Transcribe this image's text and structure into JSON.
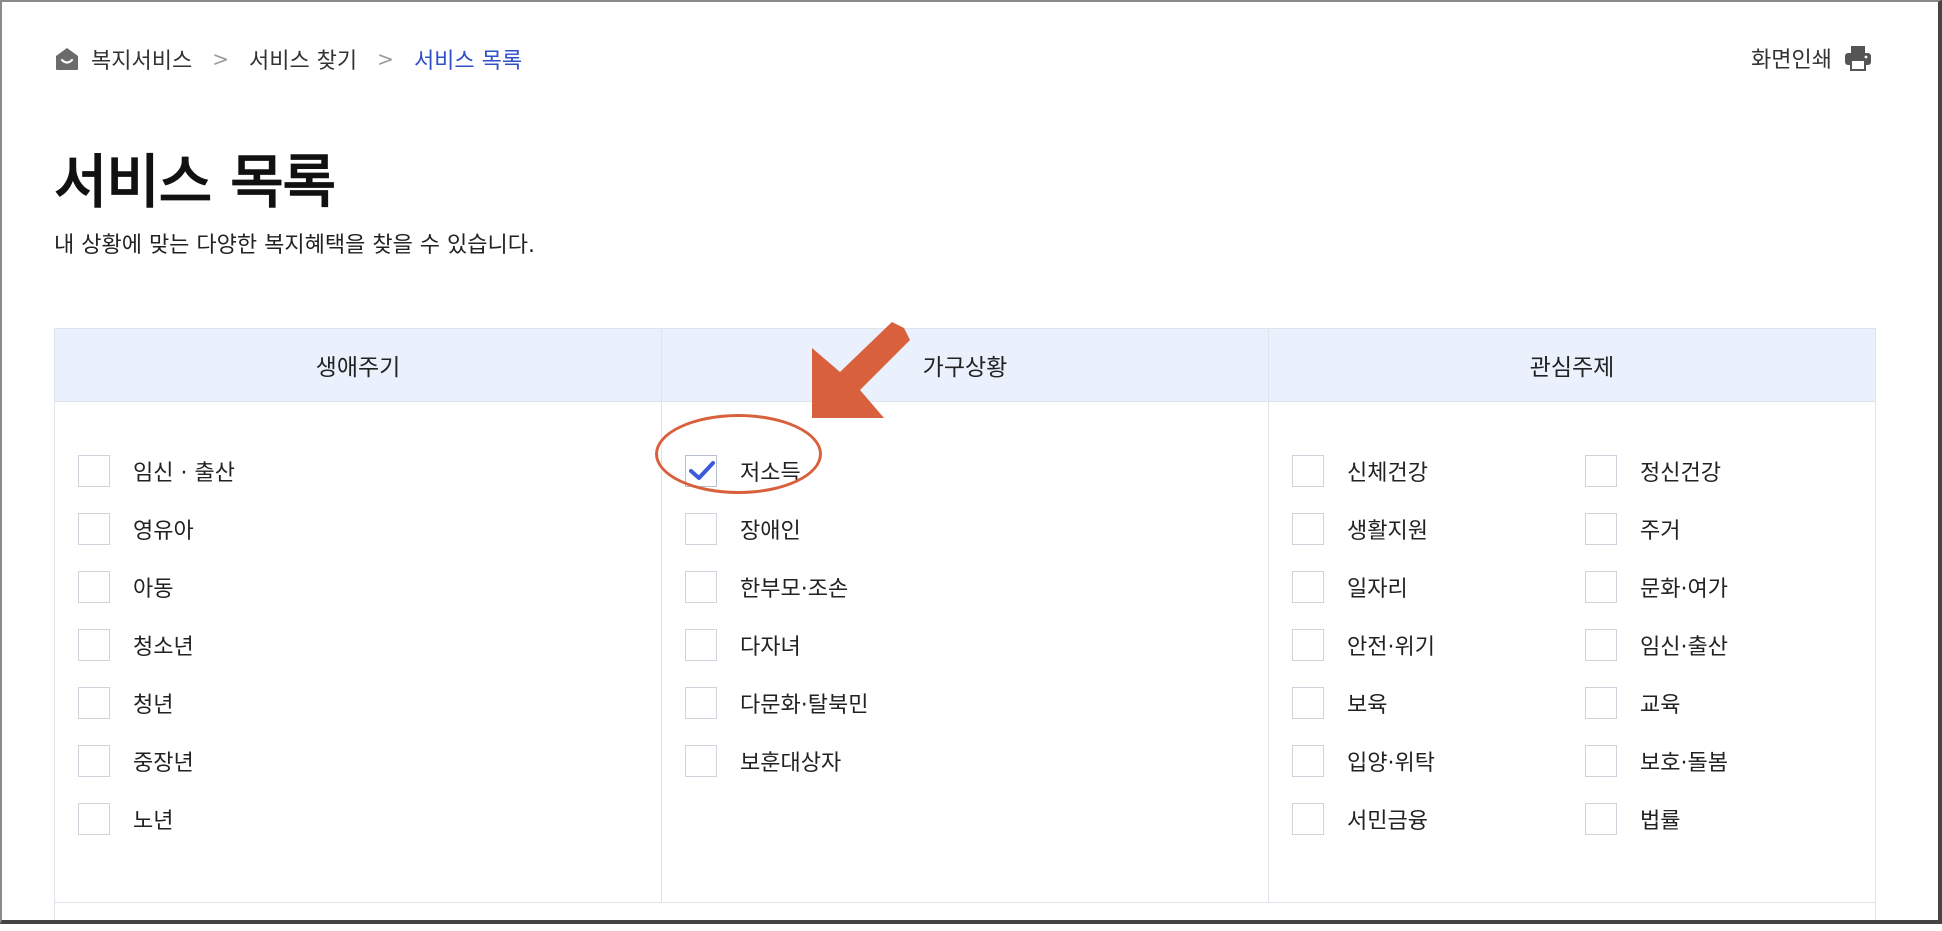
{
  "breadcrumb": {
    "items": [
      "복지서비스",
      "서비스 찾기",
      "서비스 목록"
    ],
    "separator": ">"
  },
  "print": {
    "label": "화면인쇄"
  },
  "page": {
    "title": "서비스 목록",
    "description": "내 상황에 맞는 다양한 복지혜택을 찾을 수 있습니다."
  },
  "filters": {
    "headers": [
      "생애주기",
      "가구상황",
      "관심주제"
    ],
    "life_cycle": [
      "임신 · 출산",
      "영유아",
      "아동",
      "청소년",
      "청년",
      "중장년",
      "노년"
    ],
    "household": [
      "저소득",
      "장애인",
      "한부모·조손",
      "다자녀",
      "다문화·탈북민",
      "보훈대상자"
    ],
    "household_checked": "저소득",
    "interest_col1": [
      "신체건강",
      "생활지원",
      "일자리",
      "안전·위기",
      "보육",
      "입양·위탁",
      "서민금융"
    ],
    "interest_col2": [
      "정신건강",
      "주거",
      "문화·여가",
      "임신·출산",
      "교육",
      "보호·돌봄",
      "법률"
    ]
  },
  "colors": {
    "accent": "#2d4fc9",
    "header_bg": "#eaf0fc",
    "annotation": "#d9603d",
    "check": "#3b5bdb"
  }
}
